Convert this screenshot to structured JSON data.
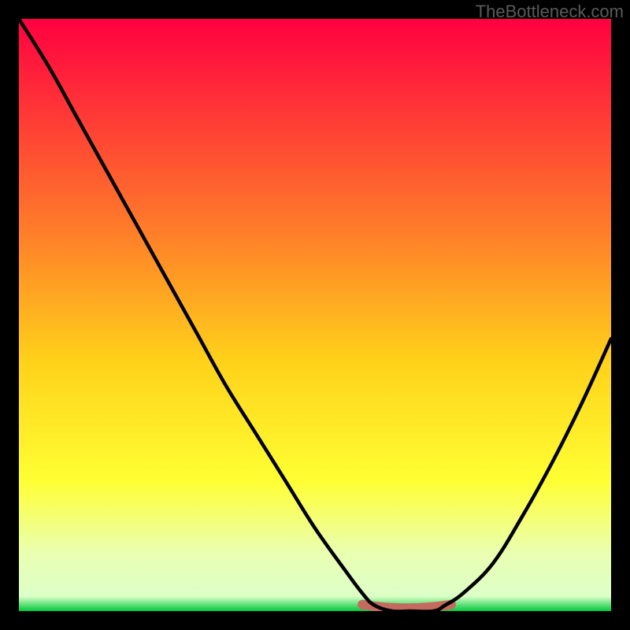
{
  "watermark": "TheBottleneck.com",
  "chart_data": {
    "type": "line",
    "title": "",
    "xlabel": "",
    "ylabel": "",
    "xlim": [
      0,
      100
    ],
    "ylim": [
      0,
      100
    ],
    "x": [
      0,
      5,
      10,
      15,
      20,
      25,
      30,
      35,
      40,
      45,
      50,
      55,
      58,
      60,
      63,
      66,
      70,
      72,
      75,
      80,
      85,
      90,
      95,
      100
    ],
    "values": [
      100,
      92,
      83,
      74,
      65,
      56,
      47,
      38,
      30,
      22,
      14,
      7,
      3,
      1,
      0,
      0,
      0,
      1,
      3,
      8,
      16,
      25,
      35,
      46
    ],
    "trough": {
      "x_start": 58,
      "x_end": 73,
      "y": 0.5
    },
    "gradient_stops": [
      {
        "offset": 0.0,
        "color": "#ff0040"
      },
      {
        "offset": 0.35,
        "color": "#ff7a2a"
      },
      {
        "offset": 0.58,
        "color": "#ffd21a"
      },
      {
        "offset": 0.78,
        "color": "#ffff33"
      },
      {
        "offset": 0.9,
        "color": "#eaffb0"
      },
      {
        "offset": 0.975,
        "color": "#dcffc8"
      },
      {
        "offset": 1.0,
        "color": "#00c83c"
      }
    ],
    "frame_color": "#000000",
    "curve_color": "#000000",
    "trough_band_color": "#c46a5f"
  }
}
